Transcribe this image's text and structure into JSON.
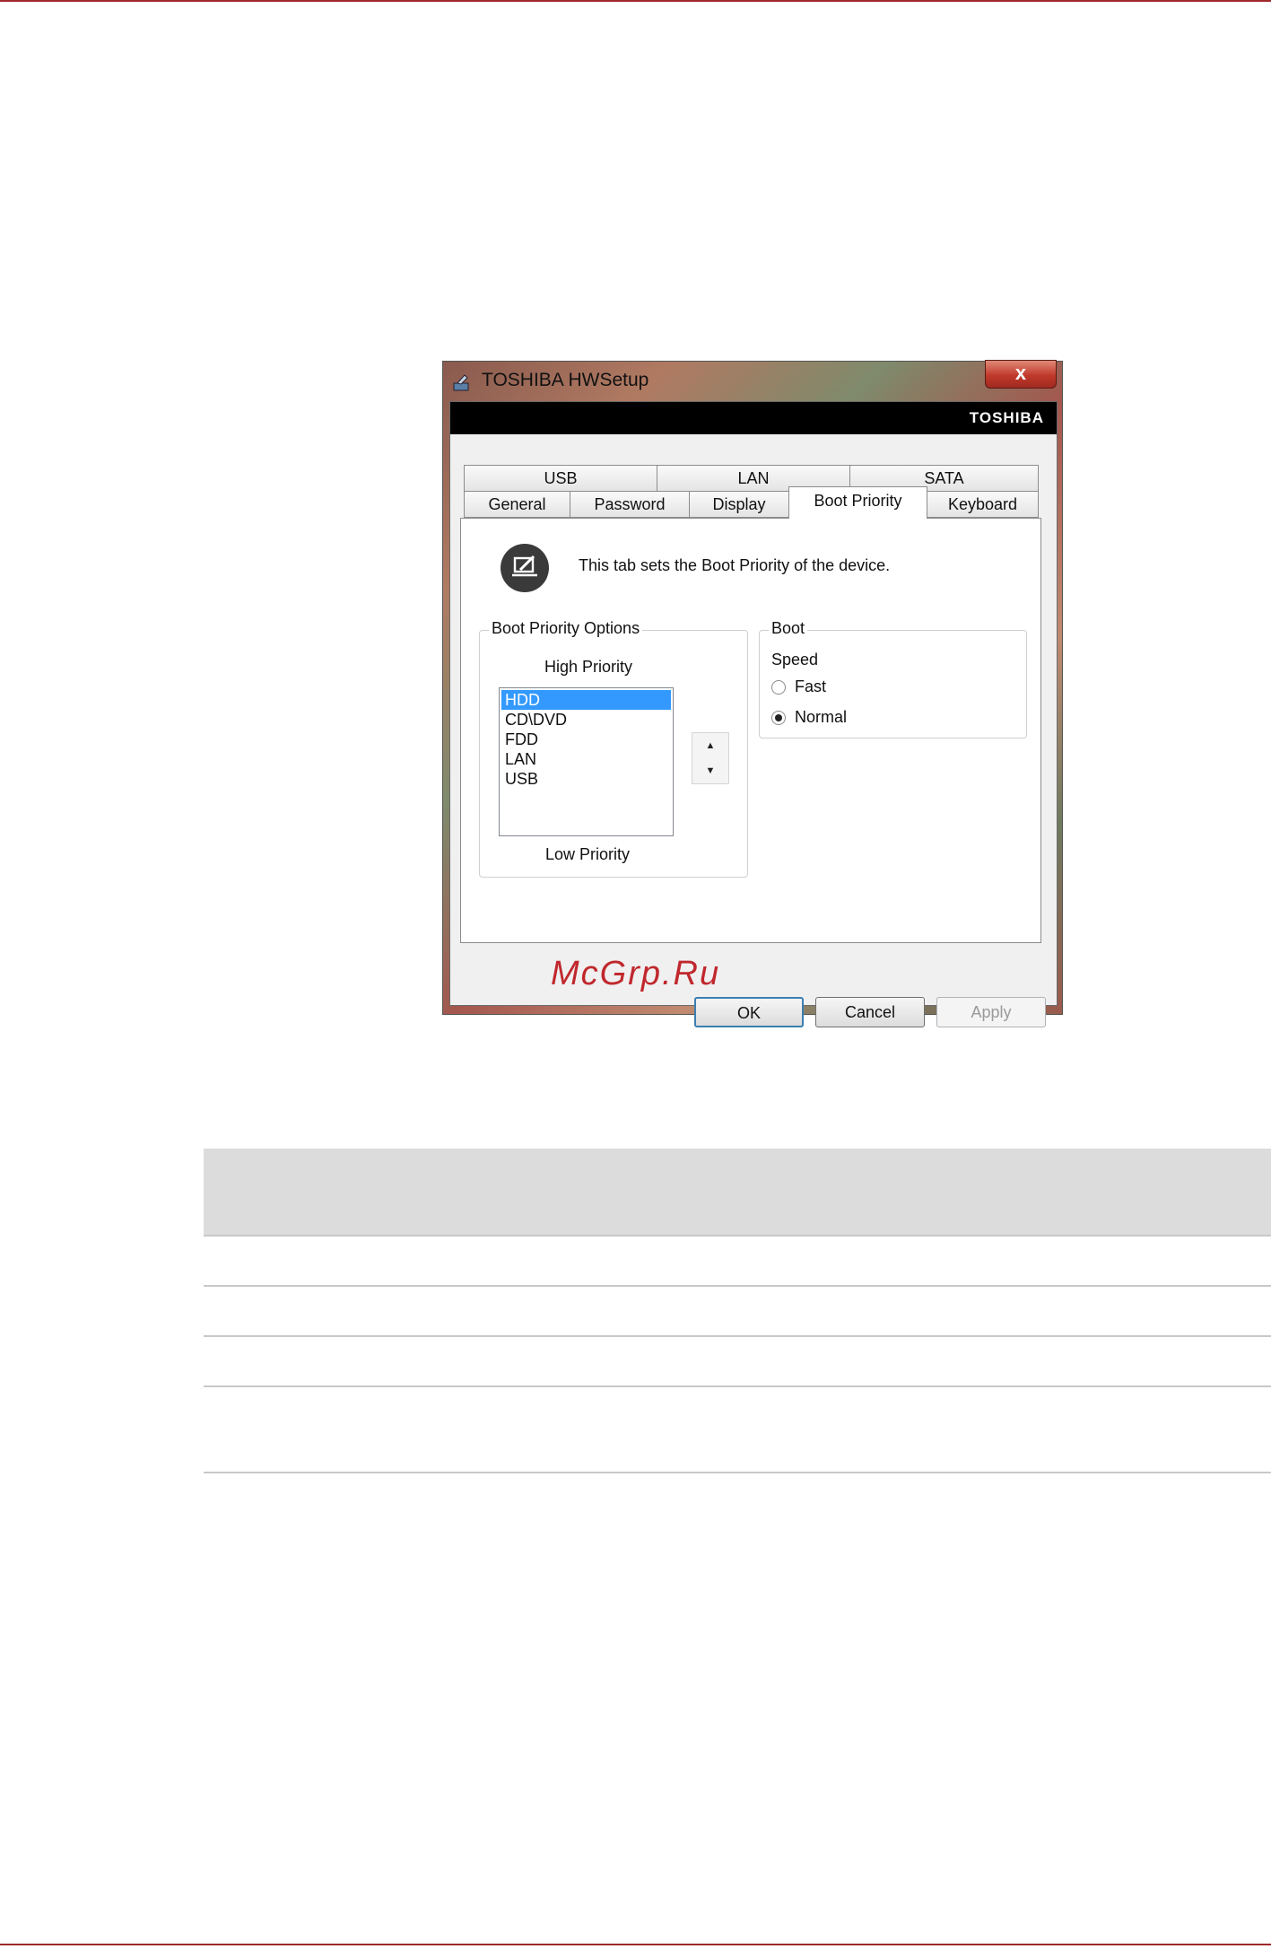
{
  "window": {
    "title": "TOSHIBA HWSetup",
    "close_label": "x",
    "brand": "TOSHIBA"
  },
  "tabs": {
    "row_back": [
      {
        "label": "USB"
      },
      {
        "label": "LAN"
      },
      {
        "label": "SATA"
      }
    ],
    "row_front": [
      {
        "label": "General"
      },
      {
        "label": "Password"
      },
      {
        "label": "Display"
      },
      {
        "label": "Boot Priority",
        "active": true
      },
      {
        "label": "Keyboard"
      }
    ]
  },
  "panel": {
    "info_text": "This tab sets the Boot Priority of the device.",
    "boot_priority_options": {
      "title": "Boot Priority Options",
      "high_label": "High Priority",
      "low_label": "Low Priority",
      "items": [
        "HDD",
        "CD\\DVD",
        "FDD",
        "LAN",
        "USB"
      ],
      "selected": "HDD",
      "up_glyph": "▲",
      "down_glyph": "▼"
    },
    "boot": {
      "title": "Boot",
      "speed_label": "Speed",
      "options": [
        {
          "label": "Fast",
          "checked": false
        },
        {
          "label": "Normal",
          "checked": true
        }
      ]
    }
  },
  "buttons": {
    "ok": "OK",
    "cancel": "Cancel",
    "apply": "Apply"
  },
  "watermark": "McGrp.Ru",
  "colors": {
    "accent_rule": "#a0282d",
    "selection": "#3399ff",
    "watermark": "#c0282d"
  },
  "icons": {
    "app": "toshiba-app-icon",
    "info": "settings-pen-icon"
  }
}
